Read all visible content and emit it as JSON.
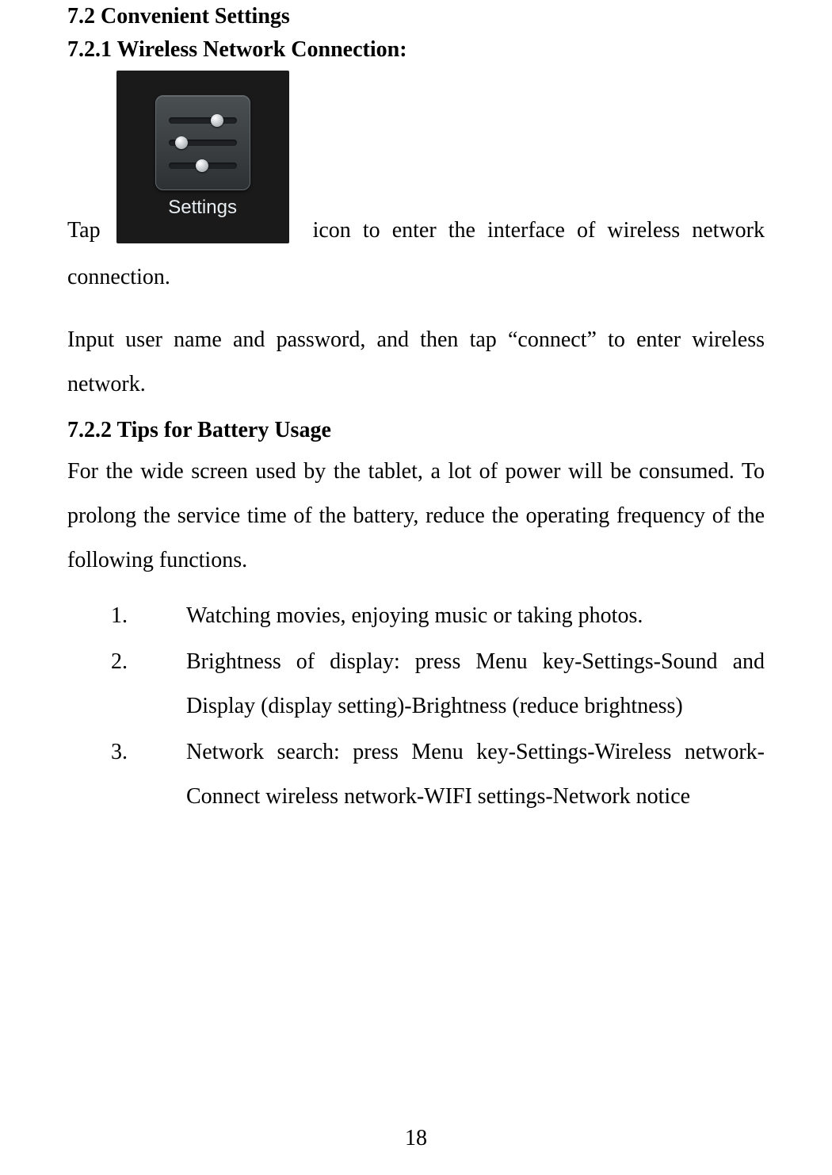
{
  "headings": {
    "h1": "7.2 Convenient Settings",
    "h2": "7.2.1 Wireless Network Connection:",
    "h3": "7.2.2 Tips for Battery Usage"
  },
  "settings_icon": {
    "label": "Settings",
    "name": "settings-app-icon"
  },
  "tap_sentence": {
    "word_tap": "Tap",
    "rest_inline": "icon  to  enter  the  interface  of  wireless  network",
    "continuation": "connection."
  },
  "input_instruction": "Input user name and password, and then tap “connect” to enter wireless network.",
  "battery_intro": "For the wide screen used by the tablet, a lot of power will be consumed. To prolong the service time of the battery, reduce the operating frequency of the following functions.",
  "tips": [
    "Watching movies, enjoying music or taking photos.",
    "Brightness of display: press Menu key-Settings-Sound and Display (display setting)-Brightness (reduce brightness)",
    "Network search: press Menu key-Settings-Wireless network-Connect wireless network-WIFI settings-Network notice"
  ],
  "page_number": "18"
}
